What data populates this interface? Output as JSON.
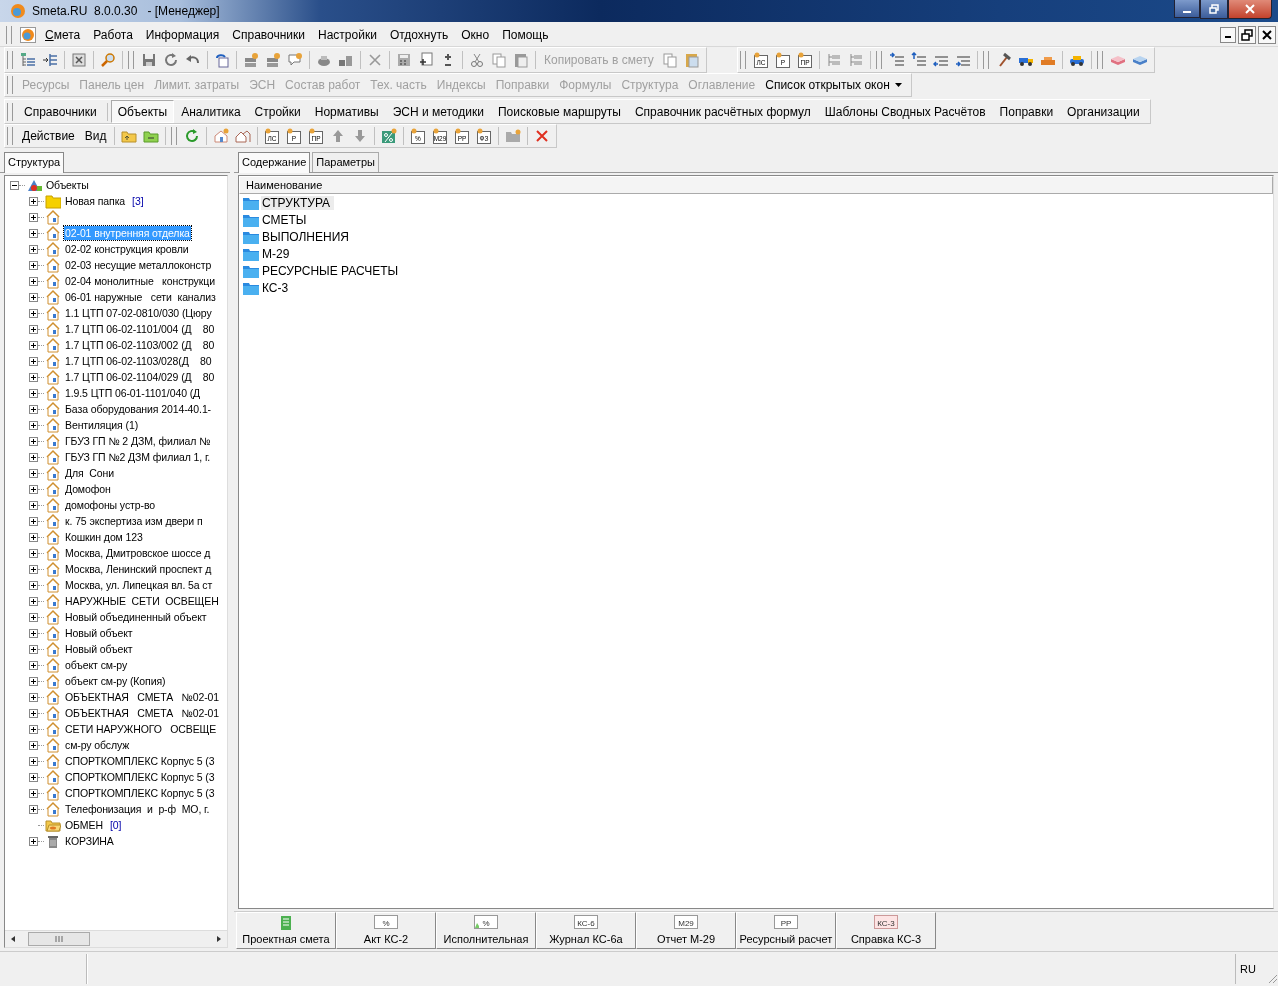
{
  "window": {
    "title": "Smeta.RU  8.0.0.30   - [Менеджер]"
  },
  "menu": [
    {
      "label": "Смета",
      "underline_first": true
    },
    {
      "label": "Работа",
      "underline_first": false
    },
    {
      "label": "Информация",
      "underline_first": false
    },
    {
      "label": "Справочники",
      "underline_first": false
    },
    {
      "label": "Настройки",
      "underline_first": false
    },
    {
      "label": "Отдохнуть",
      "underline_first": false
    },
    {
      "label": "Окно",
      "underline_first": false
    },
    {
      "label": "Помощь",
      "underline_first": false
    }
  ],
  "toolbar_1": {
    "copy_button": {
      "label": "Копировать в смету",
      "disabled": true
    },
    "doc_icons": [
      "ЛС",
      "Р",
      "ПР"
    ]
  },
  "toolbar_2": [
    {
      "label": "Ресурсы",
      "disabled": true,
      "dropdown": false
    },
    {
      "label": "Панель цен",
      "disabled": true,
      "dropdown": false
    },
    {
      "label": "Лимит. затраты",
      "disabled": true,
      "dropdown": false
    },
    {
      "label": "ЭСН",
      "disabled": true,
      "dropdown": false
    },
    {
      "label": "Состав работ",
      "disabled": true,
      "dropdown": false
    },
    {
      "label": "Тех. часть",
      "disabled": true,
      "dropdown": false
    },
    {
      "label": "Индексы",
      "disabled": true,
      "dropdown": false
    },
    {
      "label": "Поправки",
      "disabled": true,
      "dropdown": false
    },
    {
      "label": "Формулы",
      "disabled": true,
      "dropdown": false
    },
    {
      "label": "Структура",
      "disabled": true,
      "dropdown": false
    },
    {
      "label": "Оглавление",
      "disabled": true,
      "dropdown": false
    },
    {
      "label": "Список открытых окон",
      "disabled": false,
      "dropdown": true
    }
  ],
  "tabs": [
    {
      "label": "Справочники",
      "selected": false
    },
    {
      "label": "Объекты",
      "selected": true
    },
    {
      "label": "Аналитика",
      "selected": false
    },
    {
      "label": "Стройки",
      "selected": false
    },
    {
      "label": "Нормативы",
      "selected": false
    },
    {
      "label": "ЭСН и методики",
      "selected": false
    },
    {
      "label": "Поисковые маршруты",
      "selected": false
    },
    {
      "label": "Справочник расчётных формул",
      "selected": false
    },
    {
      "label": "Шаблоны Сводных Расчётов",
      "selected": false
    },
    {
      "label": "Поправки",
      "selected": false
    },
    {
      "label": "Организации",
      "selected": false
    }
  ],
  "action_bar": {
    "menus": [
      "Действие",
      "Вид"
    ],
    "doc_icons_1": [
      "ЛС",
      "Р",
      "ПР"
    ],
    "doc_icons_2": [
      "%",
      "М29",
      "РР",
      "ФЗ"
    ]
  },
  "left_panel": {
    "tab": "Структура",
    "tree": {
      "label": "Объекты",
      "kind": "root",
      "expanded": true,
      "selected": false,
      "children": [
        {
          "label": "Новая папка",
          "count": "[3]",
          "kind": "folder",
          "expanded": false,
          "selected": false
        },
        {
          "kind": "object",
          "expanded": false,
          "selected": false
        },
        {
          "label": "02-01 внутренняя отделка",
          "kind": "object",
          "expanded": false,
          "selected": true
        },
        {
          "label": "02-02 конструкция кровли",
          "kind": "object",
          "expanded": false,
          "selected": false
        },
        {
          "label": "02-03 несущие металлоконстр",
          "kind": "object",
          "expanded": false,
          "selected": false
        },
        {
          "label": "02-04 монолитные   конструкци",
          "kind": "object",
          "expanded": false,
          "selected": false
        },
        {
          "label": "06-01 наружные   сети  канализ",
          "kind": "object",
          "expanded": false,
          "selected": false
        },
        {
          "label": "1.1 ЦТП 07-02-0810/030 (Цюру",
          "kind": "object",
          "expanded": false,
          "selected": false
        },
        {
          "label": "1.7 ЦТП 06-02-1101/004 (Д    80",
          "kind": "object",
          "expanded": false,
          "selected": false
        },
        {
          "label": "1.7 ЦТП 06-02-1103/002 (Д    80",
          "kind": "object",
          "expanded": false,
          "selected": false
        },
        {
          "label": "1.7 ЦТП 06-02-1103/028(Д    80",
          "kind": "object",
          "expanded": false,
          "selected": false
        },
        {
          "label": "1.7 ЦТП 06-02-1104/029 (Д    80",
          "kind": "object",
          "expanded": false,
          "selected": false
        },
        {
          "label": "1.9.5 ЦТП 06-01-1101/040 (Д",
          "kind": "object",
          "expanded": false,
          "selected": false
        },
        {
          "label": "База оборудования 2014-40.1-",
          "kind": "object",
          "expanded": false,
          "selected": false
        },
        {
          "label": "Вентиляция (1)",
          "kind": "object",
          "expanded": false,
          "selected": false
        },
        {
          "label": "ГБУЗ ГП № 2 ДЗМ, филиал №",
          "kind": "object",
          "expanded": false,
          "selected": false
        },
        {
          "label": "ГБУЗ ГП №2 ДЗМ филиал 1, г.",
          "kind": "object",
          "expanded": false,
          "selected": false
        },
        {
          "label": "Для  Сони",
          "kind": "object",
          "expanded": false,
          "selected": false
        },
        {
          "label": "Домофон",
          "kind": "object",
          "expanded": false,
          "selected": false
        },
        {
          "label": "домофоны устр-во",
          "kind": "object",
          "expanded": false,
          "selected": false
        },
        {
          "label": "к. 75 экспертиза изм двери п",
          "kind": "object",
          "expanded": false,
          "selected": false
        },
        {
          "label": "Кошкин дом 123",
          "kind": "object",
          "expanded": false,
          "selected": false
        },
        {
          "label": "Москва, Дмитровское шоссе д",
          "kind": "object",
          "expanded": false,
          "selected": false
        },
        {
          "label": "Москва, Ленинский проспект д",
          "kind": "object",
          "expanded": false,
          "selected": false
        },
        {
          "label": "Москва, ул. Липецкая вл. 5а ст",
          "kind": "object",
          "expanded": false,
          "selected": false
        },
        {
          "label": "НАРУЖНЫЕ  СЕТИ  ОСВЕЩЕН",
          "kind": "object",
          "expanded": false,
          "selected": false
        },
        {
          "label": "Новый объединенный объект",
          "kind": "object",
          "expanded": false,
          "selected": false
        },
        {
          "label": "Новый объект",
          "kind": "object",
          "expanded": false,
          "selected": false
        },
        {
          "label": "Новый объект",
          "kind": "object",
          "expanded": false,
          "selected": false
        },
        {
          "label": "объект см-ру",
          "kind": "object",
          "expanded": false,
          "selected": false
        },
        {
          "label": "объект см-ру (Копия)",
          "kind": "object",
          "expanded": false,
          "selected": false
        },
        {
          "label": "ОБЪЕКТНАЯ   СМЕТА   №02-01",
          "kind": "object",
          "expanded": false,
          "selected": false
        },
        {
          "label": "ОБЪЕКТНАЯ   СМЕТА   №02-01",
          "kind": "object",
          "expanded": false,
          "selected": false
        },
        {
          "label": "СЕТИ НАРУЖНОГО   ОСВЕЩЕ",
          "kind": "object",
          "expanded": false,
          "selected": false
        },
        {
          "label": "см-ру обслуж",
          "kind": "object",
          "expanded": false,
          "selected": false
        },
        {
          "label": "СПОРТКОМПЛЕКС Корпус 5 (3",
          "kind": "object",
          "expanded": false,
          "selected": false
        },
        {
          "label": "СПОРТКОМПЛЕКС Корпус 5 (3",
          "kind": "object",
          "expanded": false,
          "selected": false
        },
        {
          "label": "СПОРТКОМПЛЕКС Корпус 5 (3",
          "kind": "object",
          "expanded": false,
          "selected": false
        },
        {
          "label": "Телефонизация  и  р-ф  МО, г.",
          "kind": "object",
          "expanded": false,
          "selected": false
        },
        {
          "label": "ОБМЕН",
          "count": "[0]",
          "kind": "exchange",
          "expanded": false,
          "selected": false
        },
        {
          "label": "КОРЗИНА",
          "kind": "trash",
          "expanded": false,
          "selected": false
        }
      ]
    }
  },
  "right_panel": {
    "tabs": [
      {
        "label": "Содержание",
        "selected": true
      },
      {
        "label": "Параметры",
        "selected": false
      }
    ],
    "column": "Наименование",
    "rows": [
      {
        "label": "СТРУКТУРА",
        "selected": true
      },
      {
        "label": "СМЕТЫ",
        "selected": false
      },
      {
        "label": "ВЫПОЛНЕНИЯ",
        "selected": false
      },
      {
        "label": "М-29",
        "selected": false
      },
      {
        "label": "РЕСУРСНЫЕ РАСЧЕТЫ",
        "selected": false
      },
      {
        "label": "КС-3",
        "selected": false
      }
    ],
    "buttons": [
      {
        "label": "Проектная смета",
        "kind": "sheet"
      },
      {
        "label": "Акт КС-2",
        "kind": "doc",
        "icon_text": "%"
      },
      {
        "label": "Исполнительная",
        "kind": "doc-green",
        "icon_text": "%"
      },
      {
        "label": "Журнал КС-6а",
        "kind": "doc",
        "icon_text": "КС-6"
      },
      {
        "label": "Отчет М-29",
        "kind": "doc",
        "icon_text": "М29"
      },
      {
        "label": "Ресурсный расчет",
        "kind": "doc",
        "icon_text": "РР"
      },
      {
        "label": "Справка КС-3",
        "kind": "doc-pink",
        "icon_text": "КС-3"
      }
    ]
  },
  "status_bar": {
    "language": "RU"
  }
}
